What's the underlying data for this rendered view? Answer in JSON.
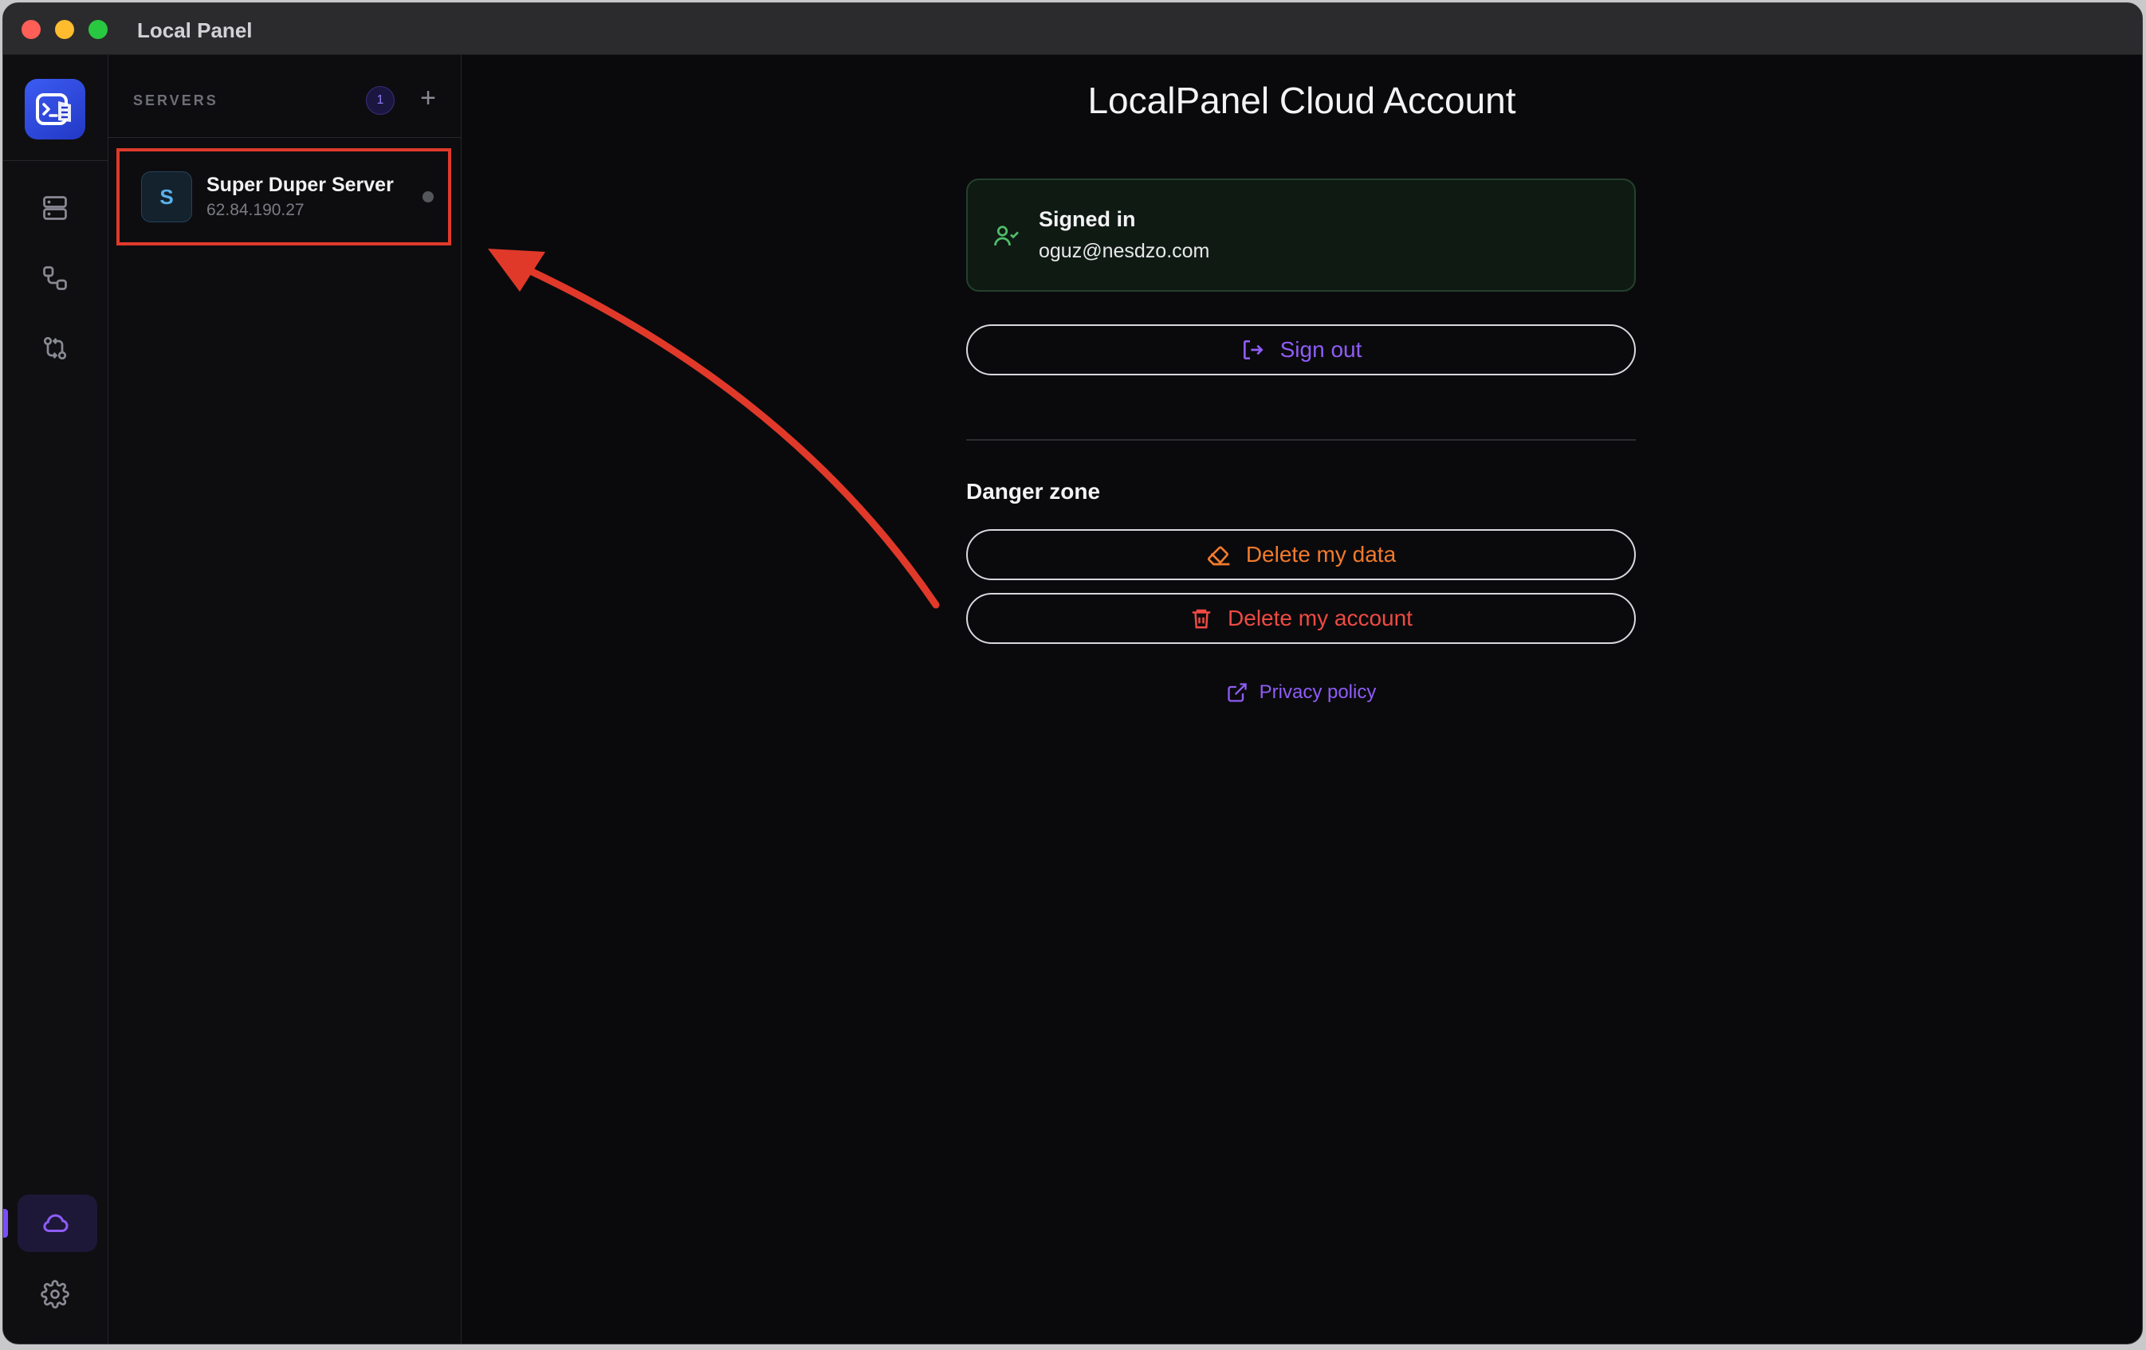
{
  "window": {
    "title": "Local Panel"
  },
  "sidebar": {
    "servers_label": "SERVERS",
    "servers_count": "1",
    "add_label": "+"
  },
  "server": {
    "avatar_letter": "S",
    "name": "Super Duper Server",
    "ip": "62.84.190.27"
  },
  "main": {
    "title": "LocalPanel Cloud Account",
    "signed_in_title": "Signed in",
    "signed_in_email": "oguz@nesdzo.com",
    "sign_out_label": "Sign out",
    "danger_zone_label": "Danger zone",
    "delete_data_label": "Delete my data",
    "delete_account_label": "Delete my account",
    "privacy_label": "Privacy policy"
  },
  "colors": {
    "accent": "#8f5cf7",
    "danger_orange": "#f27a2c",
    "danger_red": "#ef4a43",
    "success_green": "#4fbf6a",
    "annotation_red": "#e0392a"
  },
  "icons": [
    "server-stack-icon",
    "route-icon",
    "git-compare-icon",
    "cloud-icon",
    "gear-icon",
    "user-check-icon",
    "log-out-icon",
    "eraser-icon",
    "trash-icon",
    "external-link-icon"
  ]
}
